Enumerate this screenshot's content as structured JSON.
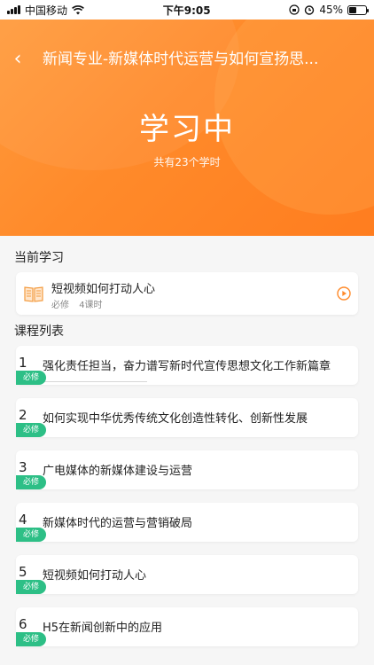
{
  "status_bar": {
    "carrier": "中国移动",
    "time": "下午9:05",
    "battery": "45%",
    "battery_level": 0.45
  },
  "header": {
    "back_icon": "chevron-left-icon",
    "title": "新闻专业-新媒体时代运营与如何宣扬思...",
    "status": "学习中",
    "summary": "共有23个学时"
  },
  "current": {
    "heading": "当前学习",
    "course_name": "短视频如何打动人心",
    "type": "必修",
    "hours": "4课时",
    "book_icon": "open-book-icon",
    "play_icon": "play-circle-icon"
  },
  "list": {
    "heading": "课程列表",
    "items": [
      {
        "num": "1",
        "name": "强化责任担当，奋力谱写新时代宣传思想文化工作新篇章",
        "badge": "必修"
      },
      {
        "num": "2",
        "name": "如何实现中华优秀传统文化创造性转化、创新性发展",
        "badge": "必修"
      },
      {
        "num": "3",
        "name": "广电媒体的新媒体建设与运营",
        "badge": "必修"
      },
      {
        "num": "4",
        "name": "新媒体时代的运营与营销破局",
        "badge": "必修"
      },
      {
        "num": "5",
        "name": "短视频如何打动人心",
        "badge": "必修"
      },
      {
        "num": "6",
        "name": "H5在新闻创新中的应用",
        "badge": "必修"
      }
    ]
  },
  "colors": {
    "header": "#ff8a2a",
    "badge": "#2dbf86",
    "accent": "#ff8a2a",
    "background": "#f6f6f6"
  }
}
